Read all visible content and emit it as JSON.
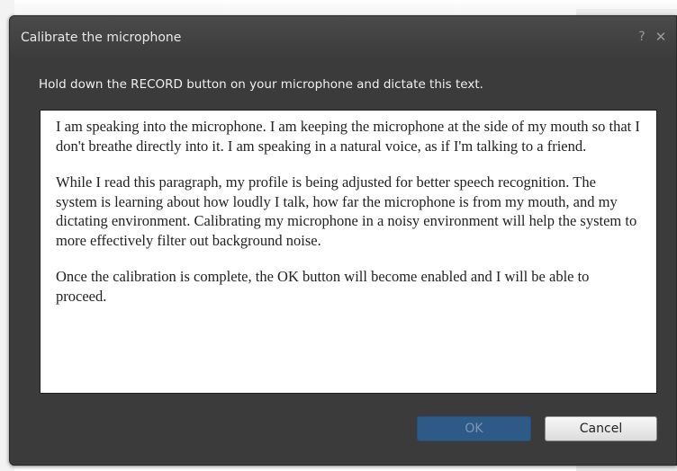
{
  "dialog": {
    "title": "Calibrate the microphone",
    "help_glyph": "?",
    "close_glyph": "✕",
    "instruction": "Hold down the RECORD button on your microphone and dictate this text.",
    "paragraphs": [
      "I am speaking into the microphone. I am keeping the microphone at the side of my mouth so that I don't breathe directly into it. I am speaking in a natural voice, as if I'm talking to a friend.",
      "While I read this paragraph, my profile is being adjusted for better speech recognition. The system is learning about how loudly I talk, how far the microphone is from my mouth, and my dictating environment. Calibrating my microphone in a noisy environment will help the system to more effectively filter out background noise.",
      "Once the calibration is complete, the OK button will become enabled and I will be able to proceed."
    ],
    "buttons": {
      "ok_label": "OK",
      "ok_enabled": false,
      "cancel_label": "Cancel"
    }
  },
  "colors": {
    "dialog_background": "#3b3b3b",
    "ok_button_disabled": "#2d5a87",
    "text_area_background": "#ffffff"
  },
  "icons": {
    "help": "help-icon",
    "close": "close-icon"
  }
}
